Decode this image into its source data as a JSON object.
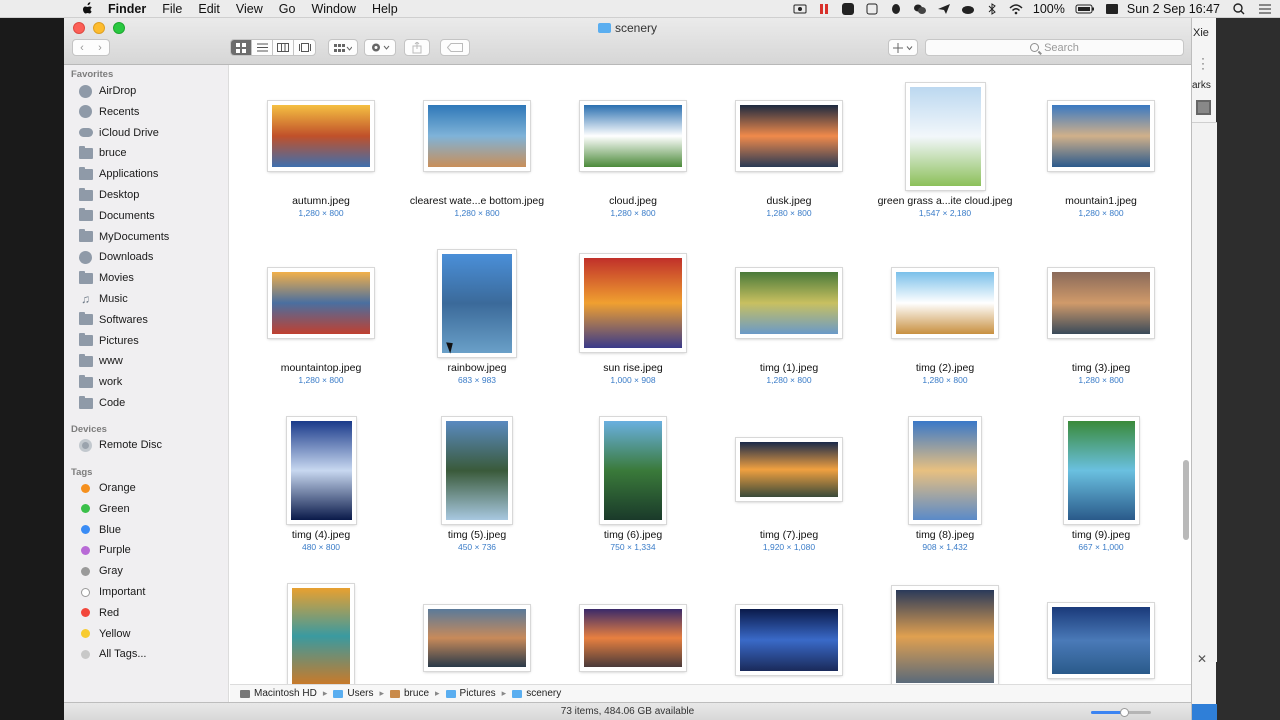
{
  "menubar": {
    "app_name": "Finder",
    "items": [
      "File",
      "Edit",
      "View",
      "Go",
      "Window",
      "Help"
    ],
    "battery": "100%",
    "datetime": "Sun 2 Sep  16:47"
  },
  "background_window": {
    "title_fragment": "Xie",
    "text_fragment": "arks"
  },
  "window": {
    "title": "scenery",
    "search_placeholder": "Search"
  },
  "sidebar": {
    "favorites_label": "Favorites",
    "favorites": [
      "AirDrop",
      "Recents",
      "iCloud Drive",
      "bruce",
      "Applications",
      "Desktop",
      "Documents",
      "MyDocuments",
      "Downloads",
      "Movies",
      "Music",
      "Softwares",
      "Pictures",
      "www",
      "work",
      "Code"
    ],
    "devices_label": "Devices",
    "devices": [
      "Remote Disc"
    ],
    "tags_label": "Tags",
    "tags": [
      {
        "name": "Orange",
        "color": "#f5901e"
      },
      {
        "name": "Green",
        "color": "#3bc04a"
      },
      {
        "name": "Blue",
        "color": "#3a8cf5"
      },
      {
        "name": "Purple",
        "color": "#b86ad6"
      },
      {
        "name": "Gray",
        "color": "#9a9a9a"
      },
      {
        "name": "Important",
        "color": "#ffffff"
      },
      {
        "name": "Red",
        "color": "#f2473c"
      },
      {
        "name": "Yellow",
        "color": "#f7cb30"
      },
      {
        "name": "All Tags...",
        "color": "#c8c8c8"
      }
    ]
  },
  "files": [
    {
      "name": "autumn.jpeg",
      "dims": "1,280 × 800"
    },
    {
      "name": "clearest wate...e bottom.jpeg",
      "dims": "1,280 × 800"
    },
    {
      "name": "cloud.jpeg",
      "dims": "1,280 × 800"
    },
    {
      "name": "dusk.jpeg",
      "dims": "1,280 × 800"
    },
    {
      "name": "green grass a...ite cloud.jpeg",
      "dims": "1,547 × 2,180"
    },
    {
      "name": "mountain1.jpeg",
      "dims": "1,280 × 800"
    },
    {
      "name": "mountaintop.jpeg",
      "dims": "1,280 × 800"
    },
    {
      "name": "rainbow.jpeg",
      "dims": "683 × 983"
    },
    {
      "name": "sun rise.jpeg",
      "dims": "1,000 × 908"
    },
    {
      "name": "timg (1).jpeg",
      "dims": "1,280 × 800"
    },
    {
      "name": "timg (2).jpeg",
      "dims": "1,280 × 800"
    },
    {
      "name": "timg (3).jpeg",
      "dims": "1,280 × 800"
    },
    {
      "name": "timg (4).jpeg",
      "dims": "480 × 800"
    },
    {
      "name": "timg (5).jpeg",
      "dims": "450 × 736"
    },
    {
      "name": "timg (6).jpeg",
      "dims": "750 × 1,334"
    },
    {
      "name": "timg (7).jpeg",
      "dims": "1,920 × 1,080"
    },
    {
      "name": "timg (8).jpeg",
      "dims": "908 × 1,432"
    },
    {
      "name": "timg (9).jpeg",
      "dims": "667 × 1,000"
    },
    {
      "name": "",
      "dims": ""
    },
    {
      "name": "",
      "dims": ""
    },
    {
      "name": "",
      "dims": ""
    },
    {
      "name": "",
      "dims": ""
    },
    {
      "name": "",
      "dims": ""
    },
    {
      "name": "",
      "dims": ""
    }
  ],
  "pathbar": [
    "Macintosh HD",
    "Users",
    "bruce",
    "Pictures",
    "scenery"
  ],
  "status": "73 items, 484.06 GB available"
}
